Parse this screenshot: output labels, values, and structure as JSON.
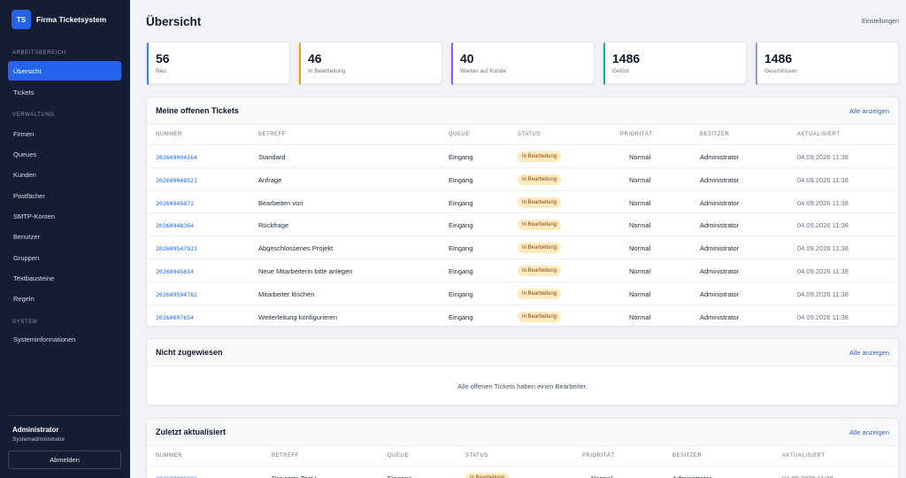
{
  "brand": {
    "logo": "TS",
    "name": "Firma Ticketsystem"
  },
  "nav": {
    "sections": [
      {
        "label": "Arbeitsbereich"
      },
      {
        "label": "Verwaltung"
      },
      {
        "label": "System"
      }
    ],
    "items": [
      {
        "label": "Übersicht",
        "active": true
      },
      {
        "label": "Tickets"
      },
      {
        "label": "Firmen"
      },
      {
        "label": "Queues"
      },
      {
        "label": "Kunden"
      },
      {
        "label": "Postfächer"
      },
      {
        "label": "SMTP-Konten"
      },
      {
        "label": "Benutzer"
      },
      {
        "label": "Gruppen"
      },
      {
        "label": "Textbausteine"
      },
      {
        "label": "Regeln"
      },
      {
        "label": "Systeminformationen"
      }
    ]
  },
  "user": {
    "name": "Administrator",
    "role": "Systemadministrator",
    "logout_label": "Abmelden"
  },
  "page": {
    "title": "Übersicht",
    "settings_label": "Einstellungen"
  },
  "stats": [
    {
      "value": "56",
      "label": "Neu",
      "color": "#3b82f6"
    },
    {
      "value": "46",
      "label": "In Bearbeitung",
      "color": "#f59e0b"
    },
    {
      "value": "40",
      "label": "Warten auf Kunde",
      "color": "#8b5cf6"
    },
    {
      "value": "1486",
      "label": "Gelöst",
      "color": "#10b981"
    },
    {
      "value": "1486",
      "label": "Geschlossen",
      "color": "#94a3b8"
    }
  ],
  "columns": [
    "Nummer",
    "Betreff",
    "Queue",
    "Status",
    "Priorität",
    "Besitzer",
    "Aktualisiert"
  ],
  "my_tickets": {
    "title": "Meine offenen Tickets",
    "link": "Alle anzeigen",
    "rows": [
      {
        "number": "202609094564",
        "subject": "Standard",
        "queue": "Eingang",
        "status": "In Bearbeitung",
        "priority": "Normal",
        "owner": "Administrator",
        "updated": "04.09.2026 11:38"
      },
      {
        "number": "202609048521",
        "subject": "Anfrage",
        "queue": "Eingang",
        "status": "In Bearbeitung",
        "priority": "Normal",
        "owner": "Administrator",
        "updated": "04.09.2026 11:38"
      },
      {
        "number": "20260945872",
        "subject": "Bearbeiten von",
        "queue": "Eingang",
        "status": "In Bearbeitung",
        "priority": "Normal",
        "owner": "Administrator",
        "updated": "04.09.2026 11:38"
      },
      {
        "number": "20260948364",
        "subject": "Rückfrage",
        "queue": "Eingang",
        "status": "In Bearbeitung",
        "priority": "Normal",
        "owner": "Administrator",
        "updated": "04.09.2026 11:38"
      },
      {
        "number": "202609547921",
        "subject": "Abgeschlossenes Projekt",
        "queue": "Eingang",
        "status": "In Bearbeitung",
        "priority": "Normal",
        "owner": "Administrator",
        "updated": "04.09.2026 11:38"
      },
      {
        "number": "20260945654",
        "subject": "Neue Mitarbeiterin bitte anlegen",
        "queue": "Eingang",
        "status": "In Bearbeitung",
        "priority": "Normal",
        "owner": "Administrator",
        "updated": "04.09.2026 11:38"
      },
      {
        "number": "202609594782",
        "subject": "Mitarbeiter löschen",
        "queue": "Eingang",
        "status": "In Bearbeitung",
        "priority": "Normal",
        "owner": "Administrator",
        "updated": "04.09.2026 11:38"
      },
      {
        "number": "20260097654",
        "subject": "Weiterleitung konfigurieren",
        "queue": "Eingang",
        "status": "In Bearbeitung",
        "priority": "Normal",
        "owner": "Administrator",
        "updated": "04.09.2026 11:38"
      }
    ]
  },
  "unassigned": {
    "title": "Nicht zugewiesen",
    "link": "Alle anzeigen",
    "empty_text": "Alle offenen Tickets haben einen Bearbeiter."
  },
  "recent": {
    "title": "Zuletzt aktualisiert",
    "link": "Alle anzeigen",
    "rows": [
      {
        "number": "202609090001",
        "subject": "Der erste Test !",
        "queue": "Eingang",
        "status": "In Bearbeitung",
        "priority": "Normal",
        "owner": "Administrator",
        "updated": "04.09.2026 11:38"
      }
    ]
  }
}
